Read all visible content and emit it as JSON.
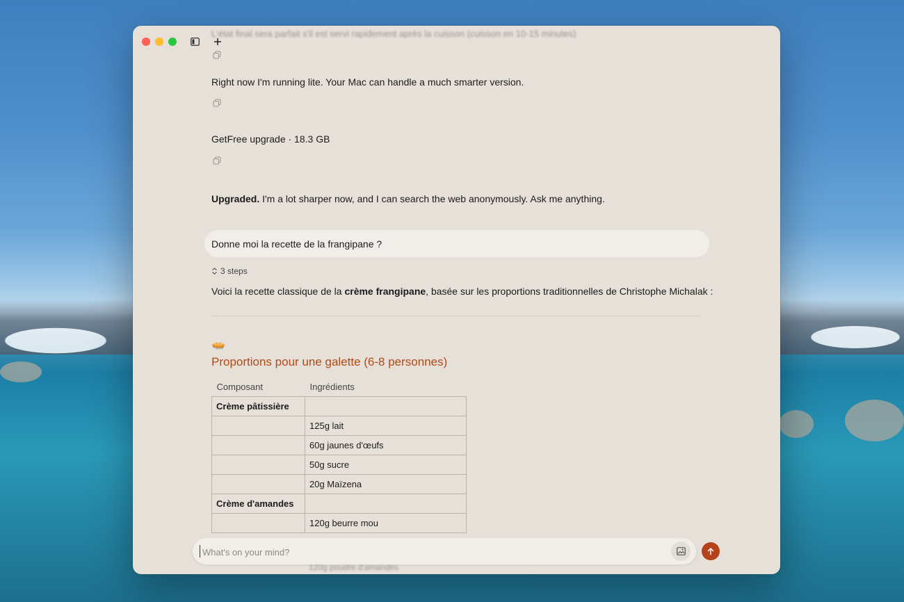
{
  "window": {
    "faded_top_text": "L'état final sera parfait s'il est servi rapidement après la cuisson (cuisson en 10-15 minutes)"
  },
  "messages": {
    "lite_note": "Right now I'm running lite. Your Mac can handle a much smarter version.",
    "upgrade": "GetFree upgrade · 18.3 GB",
    "upgraded_bold": "Upgraded.",
    "upgraded_rest": " I'm a lot sharper now, and I can search the web anonymously. Ask me anything.",
    "user_question": "Donne moi la recette de la frangipane ?",
    "steps": "3 steps",
    "answer_pre": "Voici la recette classique de la ",
    "answer_bold": "crème frangipane",
    "answer_post": ", basée sur les proportions traditionnelles de Christophe Michalak :"
  },
  "recipe": {
    "emoji": "🥧",
    "heading": "Proportions pour une galette (6-8 personnes)",
    "columns": [
      "Composant",
      "Ingrédients"
    ],
    "rows": [
      [
        "Crème pâtissière",
        ""
      ],
      [
        "",
        "125g lait"
      ],
      [
        "",
        "60g jaunes d'œufs"
      ],
      [
        "",
        "50g sucre"
      ],
      [
        "",
        "20g Maïzena"
      ],
      [
        "Crème d'amandes",
        ""
      ],
      [
        "",
        "120g beurre mou"
      ]
    ],
    "partial_hidden_row": "120g poudre d'amandes"
  },
  "input": {
    "placeholder": "What's on your mind?"
  },
  "colors": {
    "accent": "#b5421a",
    "heading": "#b24a16",
    "window_bg": "#e6e0d9"
  }
}
